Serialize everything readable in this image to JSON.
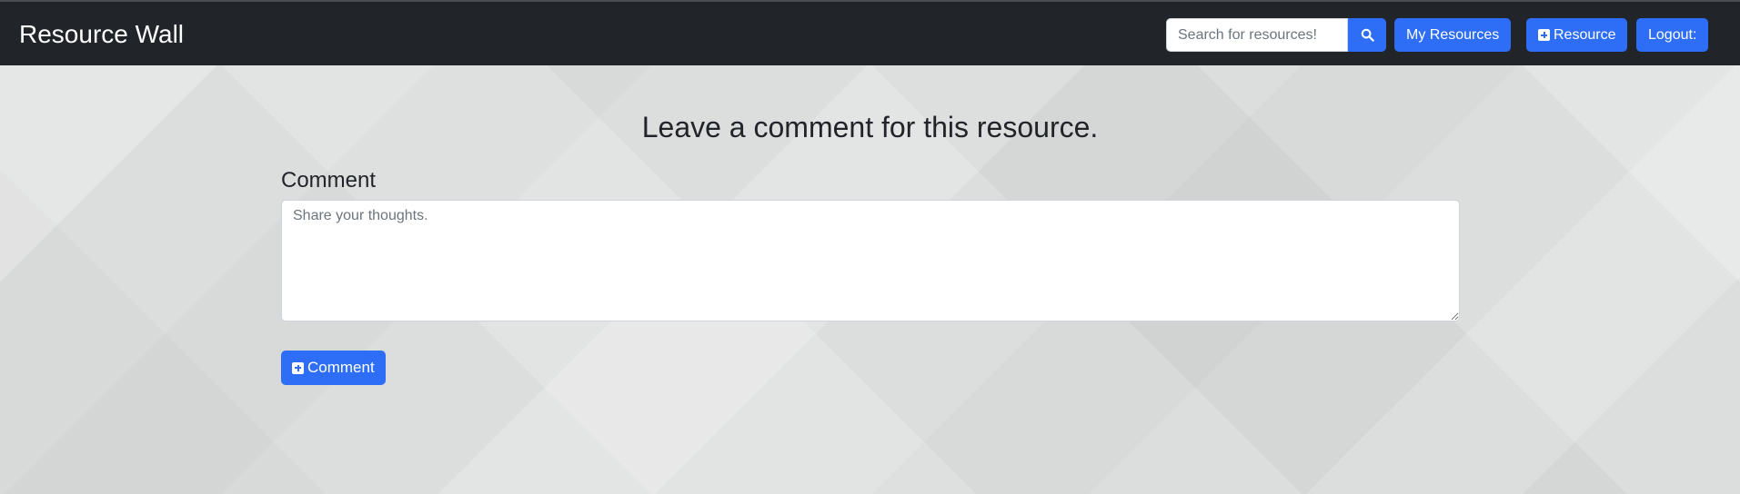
{
  "navbar": {
    "brand": "Resource Wall",
    "search": {
      "placeholder": "Search for resources!",
      "value": "",
      "button_icon": "search-icon"
    },
    "my_resources_label": "My Resources",
    "add_resource_label": "Resource",
    "add_resource_icon": "plus-square-icon",
    "logout_label": "Logout:"
  },
  "main": {
    "heading": "Leave a comment for this resource.",
    "comment_label": "Comment",
    "comment_placeholder": "Share your thoughts.",
    "comment_value": "",
    "submit_label": "Comment",
    "submit_icon": "plus-square-icon"
  },
  "colors": {
    "navbar_bg": "#212529",
    "primary": "#2e6ef7",
    "page_bg": "#dcdddd"
  }
}
